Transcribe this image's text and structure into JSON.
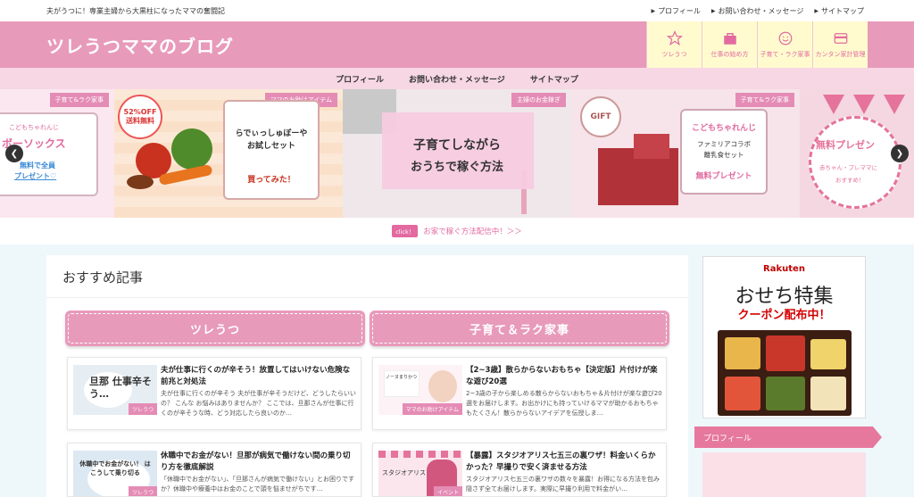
{
  "topbar": {
    "tagline": "夫がうつに！専業主婦から大黒柱になったママの奮闘記",
    "links": [
      "プロフィール",
      "お問い合わせ・メッセージ",
      "サイトマップ"
    ]
  },
  "header": {
    "title": "ツレうつママのブログ",
    "nav": [
      {
        "label": "ツレうつ",
        "icon": "star-icon"
      },
      {
        "label": "仕事の始め方",
        "icon": "bag-icon"
      },
      {
        "label": "子育て・ラク家事",
        "icon": "smile-icon"
      },
      {
        "label": "カンタン家計管理",
        "icon": "card-icon"
      }
    ]
  },
  "mainnav": [
    "プロフィール",
    "お問い合わせ・メッセージ",
    "サイトマップ"
  ],
  "slider": {
    "slides": [
      {
        "tag": "子育て&ラク家事",
        "line1": "こどもちゃれんじ",
        "line2": "ボーソックス",
        "line3": "無料で全員",
        "line4": "プレゼント♡"
      },
      {
        "tag": "ママのお助けアイテム",
        "sale1": "52%OFF",
        "sale2": "送料無料",
        "line1": "らでぃっしゅぼーや",
        "line2": "お試しセット",
        "cta": "買ってみた！"
      },
      {
        "tag": "主婦のお金稼ぎ",
        "line1": "子育てしながら",
        "line2": "おうちで稼ぐ方法"
      },
      {
        "tag": "子育て&ラク家事",
        "gift": "GIFT",
        "line1": "こどもちゃれんじ",
        "line2": "ファミリアコラボ",
        "line3": "離乳食セット",
        "line4": "無料プレゼント"
      },
      {
        "line1": "無料プレゼン",
        "line2": "赤ちゃん・プレママに",
        "line3": "おすすめ！"
      }
    ]
  },
  "promo": {
    "click": "click！",
    "text": "お家で稼ぐ方法配信中！＞＞"
  },
  "main": {
    "section_title": "おすすめ記事",
    "categories": [
      "ツレうつ",
      "子育て＆ラク家事"
    ],
    "articles": [
      {
        "title": "夫が仕事に行くのが辛そう！放置してはいけない危険な前兆と対処法",
        "excerpt": "夫が仕事に行くのが辛そう 夫が仕事が辛そうだけど、どうしたらいいの？ こんな お悩みはありませんか？ ここでは、旦那さんが仕事に行くのが辛そうな時、どう対応したら良いのか…",
        "thumb_text": "旦那 仕事辛そう…",
        "badge": "ツレうつ"
      },
      {
        "title": "【2~3歳】散らからないおもちゃ【決定版】片付けが楽な遊び20選",
        "excerpt": "2~3歳の子から楽しめる散らからないおもちゃ＆片付けが楽な遊び20選をお届けします。お出かけにも持っていけるママが助かるおもちゃもたくさん！散らからないアイデアを伝授しま…",
        "thumb_text": "ノーヌまりかつ",
        "badge": "ママのお助けアイテム"
      },
      {
        "title": "休職中でお金がない！旦那が病気で働けない間の乗り切り方を徹底解説",
        "excerpt": "「休職中でお金がない」、「旦那さんが病気で働けない」とお困りですか？休職中や療養中はお金のことで頭を悩ませがちです…",
        "thumb_text": "休職中でお金がない！ は こうして乗り切る",
        "badge": "ツレうつ"
      },
      {
        "title": "【暴露】スタジオアリス七五三の裏ワザ！料金いくらかかった？早撮りで安く済ませる方法",
        "excerpt": "スタジオアリス七五三の裏ワザの数々を暴露！お得になる方法を包み隠さず全てお届けします。実際に早撮り利用で料金がい…",
        "thumb_text": "スタジオアリス",
        "badge": "イベント"
      }
    ]
  },
  "sidebar": {
    "ad": {
      "brand": "Rakuten",
      "headline": "おせち特集",
      "sub": "クーポン配布中！"
    },
    "profile_label": "プロフィール"
  },
  "colors": {
    "header_pink": "#e89abb",
    "accent": "#e26aa0",
    "nav_yellow": "#fffbcf"
  }
}
